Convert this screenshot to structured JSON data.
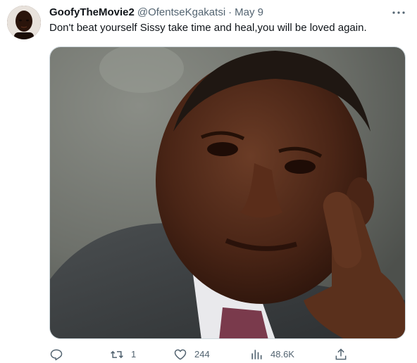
{
  "tweet": {
    "display_name": "GoofyTheMovie2",
    "handle": "@OfentseKgakatsi",
    "separator": "·",
    "date": "May 9",
    "text": "Don't beat yourself Sissy take time and heal,you will be loved again."
  },
  "icons": {
    "more": "more-icon",
    "reply": "reply-icon",
    "retweet": "retweet-icon",
    "like": "heart-icon",
    "views": "views-icon",
    "share": "share-icon"
  },
  "actions": {
    "reply_count": "",
    "retweet_count": "1",
    "like_count": "244",
    "view_count": "48.6K"
  },
  "colors": {
    "text": "#0f1419",
    "secondary": "#536471",
    "border": "#cfd9de"
  }
}
